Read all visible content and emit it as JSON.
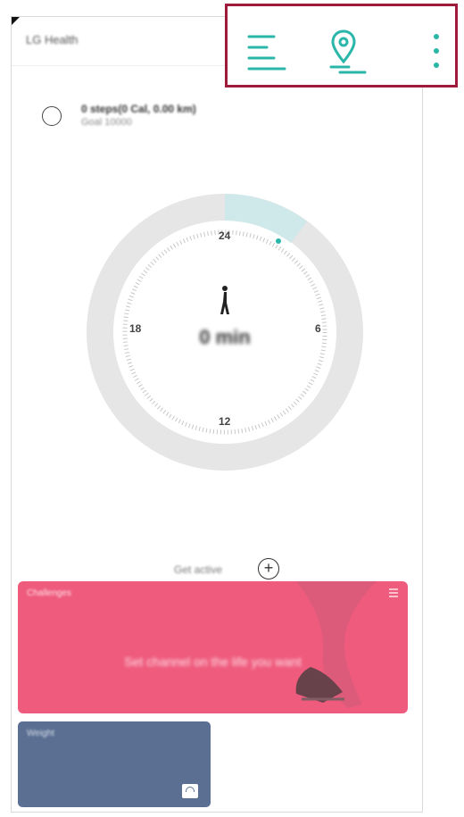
{
  "app": {
    "title": "LG Health"
  },
  "toolbar": {
    "menu_icon": "menu-lines-icon",
    "route_icon": "map-route-icon",
    "more_icon": "more-vertical-icon",
    "accent": "#2ab7a9",
    "highlight_border": "#9e1b3c"
  },
  "summary": {
    "main": "0 steps(0 Cal, 0.00 km)",
    "sub": "Goal 10000",
    "icon": "shoe-icon"
  },
  "dial": {
    "labels": {
      "top": "24",
      "right": "6",
      "bottom": "12",
      "left": "18"
    },
    "value": "0 min",
    "icon": "walking-person-icon",
    "progress_color": "#cfe8ea",
    "ring_color": "#e6e6e6"
  },
  "get_active": {
    "label": "Get active",
    "icon": "plus-circle-icon"
  },
  "cards": {
    "challenge": {
      "title": "Challenges",
      "text": "Set channel on the life you want",
      "color": "#ef5b7d"
    },
    "weight": {
      "title": "Weight",
      "icon": "scale-icon",
      "color": "#5a6f92"
    }
  }
}
